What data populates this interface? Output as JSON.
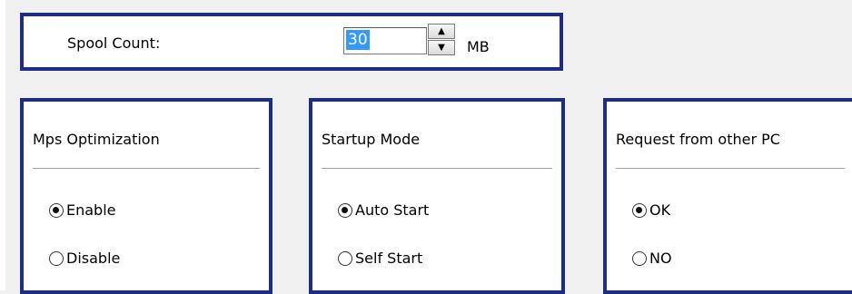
{
  "spool": {
    "label": "Spool Count:",
    "value": "30",
    "unit": "MB",
    "spin_up_glyph": "▲",
    "spin_down_glyph": "▼"
  },
  "groups": [
    {
      "title": "Mps Optimization",
      "options": [
        {
          "label": "Enable",
          "checked": true
        },
        {
          "label": "Disable",
          "checked": false
        }
      ]
    },
    {
      "title": "Startup Mode",
      "options": [
        {
          "label": "Auto Start",
          "checked": true
        },
        {
          "label": "Self Start",
          "checked": false
        }
      ]
    },
    {
      "title": "Request from other PC",
      "options": [
        {
          "label": "OK",
          "checked": true
        },
        {
          "label": "NO",
          "checked": false
        }
      ]
    }
  ],
  "colors": {
    "highlight_border": "#1f2d80",
    "selection_bg": "#3399ff",
    "window_bg": "#f0f0f0"
  }
}
